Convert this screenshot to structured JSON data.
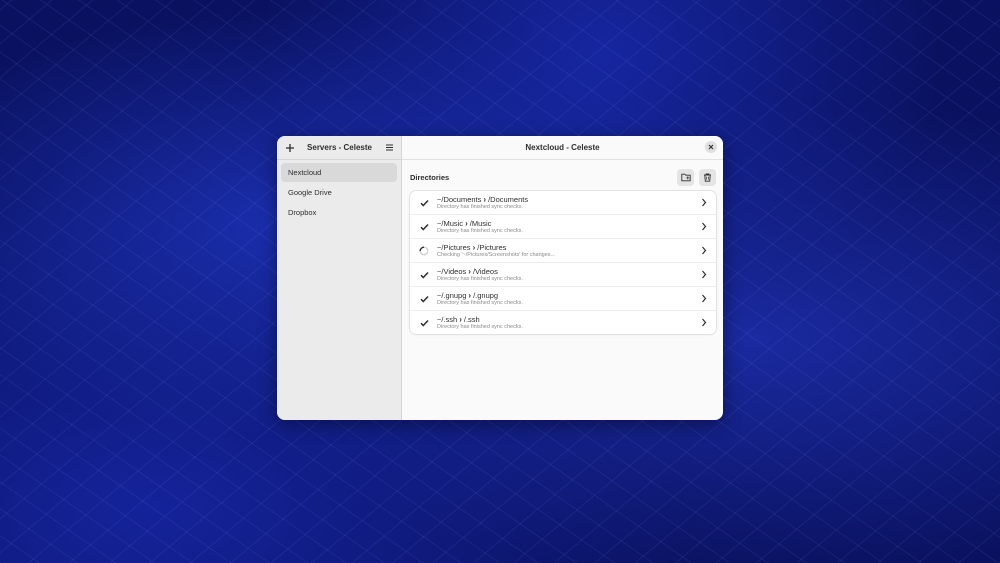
{
  "sidebar": {
    "title": "Servers - Celeste",
    "add_icon": "plus-icon",
    "menu_icon": "hamburger-menu-icon",
    "items": [
      {
        "label": "Nextcloud",
        "active": true
      },
      {
        "label": "Google Drive",
        "active": false
      },
      {
        "label": "Dropbox",
        "active": false
      }
    ]
  },
  "main": {
    "title": "Nextcloud - Celeste",
    "close_icon": "close-icon",
    "directories_label": "Directories",
    "new_folder_icon": "new-folder-icon",
    "delete_icon": "trash-icon",
    "directories": [
      {
        "local": "~/Documents",
        "remote": "/Documents",
        "status": "Directory has finished sync checks.",
        "state": "done"
      },
      {
        "local": "~/Music",
        "remote": "/Music",
        "status": "Directory has finished sync checks.",
        "state": "done"
      },
      {
        "local": "~/Pictures",
        "remote": "/Pictures",
        "status": "Checking '~/Pictures/Screenshots' for changes...",
        "state": "syncing"
      },
      {
        "local": "~/Videos",
        "remote": "/Videos",
        "status": "Directory has finished sync checks.",
        "state": "done"
      },
      {
        "local": "~/.gnupg",
        "remote": "/.gnupg",
        "status": "Directory has finished sync checks.",
        "state": "done"
      },
      {
        "local": "~/.ssh",
        "remote": "/.ssh",
        "status": "Directory has finished sync checks.",
        "state": "done"
      }
    ]
  }
}
